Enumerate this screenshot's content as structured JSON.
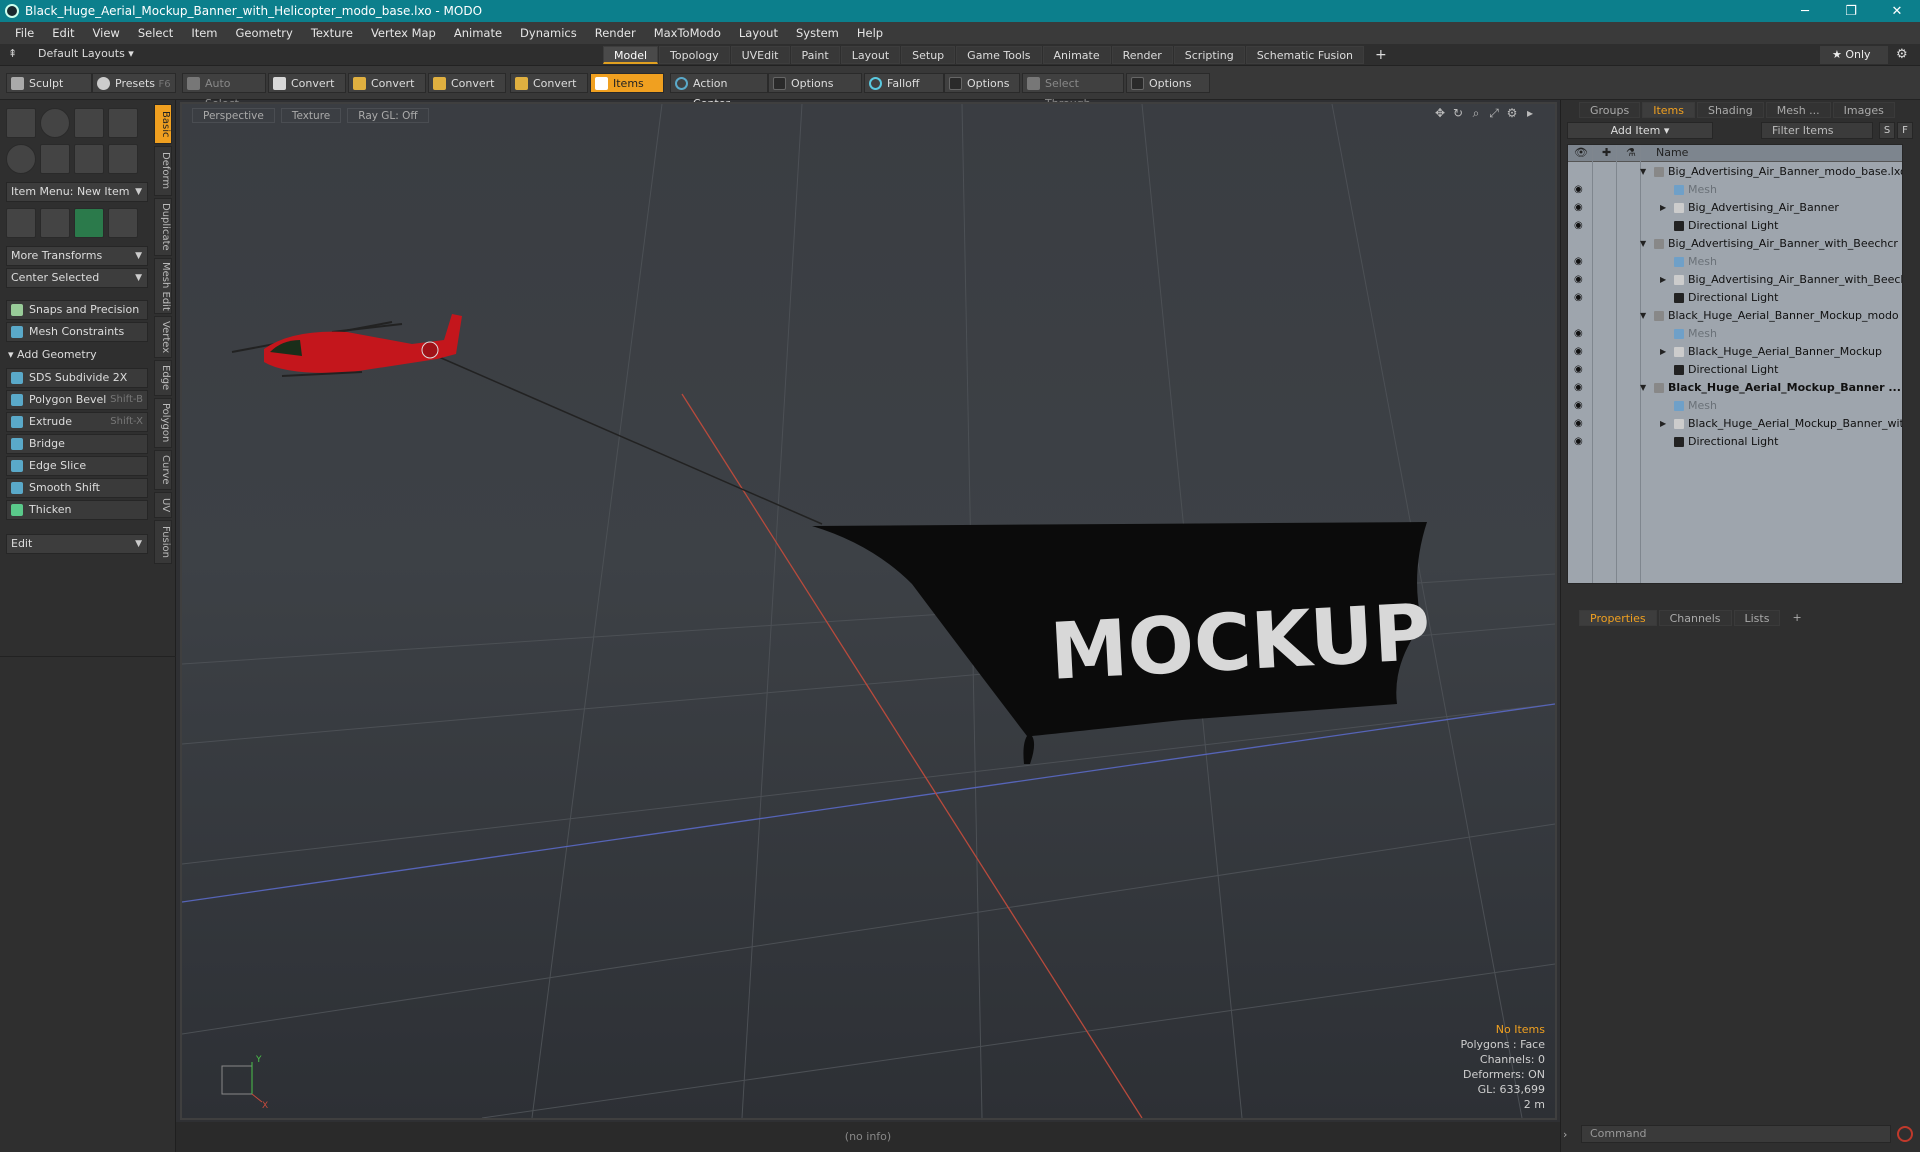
{
  "window": {
    "title": "Black_Huge_Aerial_Mockup_Banner_with_Helicopter_modo_base.lxo - MODO",
    "minimize": "─",
    "restore": "❐",
    "close": "✕"
  },
  "menu": [
    "File",
    "Edit",
    "View",
    "Select",
    "Item",
    "Geometry",
    "Texture",
    "Vertex Map",
    "Animate",
    "Dynamics",
    "Render",
    "MaxToModo",
    "Layout",
    "System",
    "Help"
  ],
  "layout_bar": {
    "default_layouts": "Default Layouts ▾",
    "tabs": [
      "Model",
      "Topology",
      "UVEdit",
      "Paint",
      "Layout",
      "Setup",
      "Game Tools",
      "Animate",
      "Render",
      "Scripting",
      "Schematic Fusion"
    ],
    "add_tab": "+",
    "only": "★  Only",
    "gear": "⚙"
  },
  "toolbar": {
    "sculpt": "Sculpt",
    "presets": "Presets",
    "presets_key": "F6",
    "auto_select": "Auto Select",
    "convert1": "Convert",
    "convert2": "Convert",
    "convert3": "Convert",
    "convert4": "Convert",
    "items": "Items",
    "action_center": "Action Center",
    "options1": "Options",
    "falloff": "Falloff",
    "options2": "Options",
    "select_through": "Select Through",
    "options3": "Options"
  },
  "left_panel": {
    "item_menu": "Item Menu: New Item",
    "more_transforms": "More Transforms",
    "center_selected": "Center Selected",
    "snaps": "Snaps and Precision",
    "mesh_constraints": "Mesh Constraints",
    "add_geometry": "Add Geometry",
    "tools": [
      {
        "label": "SDS Subdivide 2X",
        "shortcut": ""
      },
      {
        "label": "Polygon Bevel",
        "shortcut": "Shift-B"
      },
      {
        "label": "Extrude",
        "shortcut": "Shift-X"
      },
      {
        "label": "Bridge",
        "shortcut": ""
      },
      {
        "label": "Edge Slice",
        "shortcut": ""
      },
      {
        "label": "Smooth Shift",
        "shortcut": ""
      },
      {
        "label": "Thicken",
        "shortcut": ""
      }
    ],
    "edit": "Edit",
    "vertical_tabs": [
      "Basic",
      "Deform",
      "Duplicate",
      "Mesh Edit",
      "Vertex",
      "Edge",
      "Polygon",
      "Curve",
      "UV",
      "Fusion"
    ]
  },
  "viewport": {
    "perspective": "Perspective",
    "texture": "Texture",
    "raygl": "Ray GL: Off",
    "banner_text": "MOCKUP",
    "info": {
      "no_items": "No Items",
      "polygons": "Polygons : Face",
      "channels": "Channels: 0",
      "deformers": "Deformers: ON",
      "gl": "GL: 633,699",
      "scale": "2 m"
    },
    "axis_y": "Y",
    "axis_x": "X"
  },
  "status": "(no info)",
  "right_panel": {
    "tabs": [
      "Groups",
      "Items",
      "Shading",
      "Mesh ...",
      "Images"
    ],
    "add_item": "Add Item",
    "filter_items": "Filter Items",
    "s_btn": "S",
    "f_btn": "F",
    "name_header": "Name",
    "items": [
      {
        "label": "Big_Advertising_Air_Banner_modo_base.lxo",
        "level": 0,
        "type": "scene",
        "eye": false,
        "grey": false,
        "bold": false,
        "tri": "▼"
      },
      {
        "label": "Mesh",
        "level": 1,
        "type": "mesh",
        "eye": true,
        "grey": true,
        "bold": false,
        "tri": ""
      },
      {
        "label": "Big_Advertising_Air_Banner",
        "level": 1,
        "type": "group",
        "eye": true,
        "grey": false,
        "bold": false,
        "tri": "▶"
      },
      {
        "label": "Directional Light",
        "level": 1,
        "type": "light",
        "eye": true,
        "grey": false,
        "bold": false,
        "tri": ""
      },
      {
        "label": "Big_Advertising_Air_Banner_with_Beechcr ...",
        "level": 0,
        "type": "scene",
        "eye": false,
        "grey": false,
        "bold": false,
        "tri": "▼"
      },
      {
        "label": "Mesh",
        "level": 1,
        "type": "mesh",
        "eye": true,
        "grey": true,
        "bold": false,
        "tri": ""
      },
      {
        "label": "Big_Advertising_Air_Banner_with_Beech...",
        "level": 1,
        "type": "group",
        "eye": true,
        "grey": false,
        "bold": false,
        "tri": "▶"
      },
      {
        "label": "Directional Light",
        "level": 1,
        "type": "light",
        "eye": true,
        "grey": false,
        "bold": false,
        "tri": ""
      },
      {
        "label": "Black_Huge_Aerial_Banner_Mockup_modo ...",
        "level": 0,
        "type": "scene",
        "eye": false,
        "grey": false,
        "bold": false,
        "tri": "▼"
      },
      {
        "label": "Mesh",
        "level": 1,
        "type": "mesh",
        "eye": true,
        "grey": true,
        "bold": false,
        "tri": ""
      },
      {
        "label": "Black_Huge_Aerial_Banner_Mockup",
        "level": 1,
        "type": "group",
        "eye": true,
        "grey": false,
        "bold": false,
        "tri": "▶"
      },
      {
        "label": "Directional Light",
        "level": 1,
        "type": "light",
        "eye": true,
        "grey": false,
        "bold": false,
        "tri": ""
      },
      {
        "label": "Black_Huge_Aerial_Mockup_Banner ...",
        "level": 0,
        "type": "scene",
        "eye": true,
        "grey": false,
        "bold": true,
        "tri": "▼"
      },
      {
        "label": "Mesh",
        "level": 1,
        "type": "mesh",
        "eye": true,
        "grey": true,
        "bold": false,
        "tri": ""
      },
      {
        "label": "Black_Huge_Aerial_Mockup_Banner_wit ...",
        "level": 1,
        "type": "group",
        "eye": true,
        "grey": false,
        "bold": false,
        "tri": "▶"
      },
      {
        "label": "Directional Light",
        "level": 1,
        "type": "light",
        "eye": true,
        "grey": false,
        "bold": false,
        "tri": ""
      }
    ],
    "prop_tabs": [
      "Properties",
      "Channels",
      "Lists"
    ],
    "prop_add": "+",
    "command_placeholder": "Command"
  },
  "colors": {
    "accent": "#f0a020",
    "titlebar": "#0c7f8c",
    "helicopter": "#c4161c",
    "banner": "#0b0b0b"
  }
}
